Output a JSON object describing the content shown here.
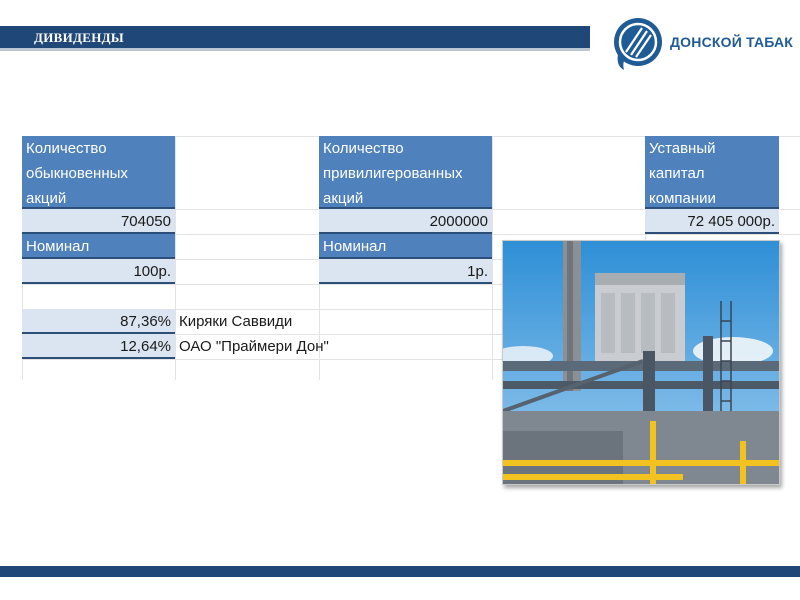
{
  "header": {
    "title": "ДИВИДЕНДЫ"
  },
  "logo": {
    "text": "ДОНСКОЙ ТАБАК"
  },
  "table": {
    "ordinary_shares": {
      "label": "Количество обыкновенных акций",
      "value": "704050",
      "nominal_label": "Номинал",
      "nominal_value": "100р."
    },
    "preferred_shares": {
      "label": "Количество привилигерованных акций",
      "value": "2000000",
      "nominal_label": "Номинал",
      "nominal_value": "1р."
    },
    "capital": {
      "label": "Уставный капитал компании",
      "value": "72 405 000р."
    },
    "shareholders": [
      {
        "share": "87,36%",
        "name": "Киряки Саввиди"
      },
      {
        "share": "12,64%",
        "name": "ОАО \"Праймери Дон\""
      }
    ]
  },
  "colors": {
    "header_bar": "#1f4878",
    "cell_header": "#4f81bd",
    "cell_value": "#dbe5f1",
    "brand": "#1f5b94"
  },
  "image": {
    "subject": "industrial-equipment-photo"
  }
}
